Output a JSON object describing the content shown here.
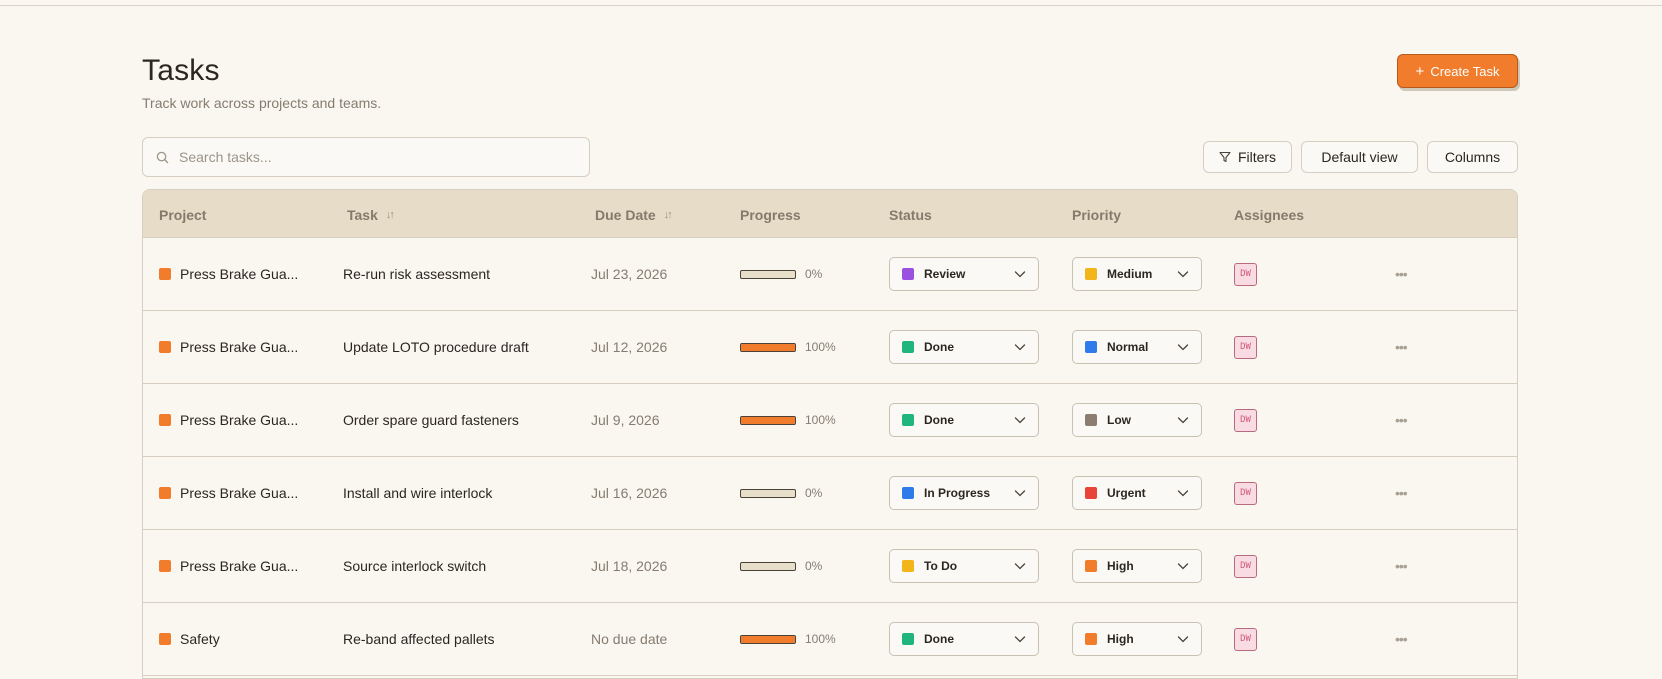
{
  "header": {
    "title": "Tasks",
    "subtitle": "Track work across projects and teams.",
    "create_label": "Create Task"
  },
  "search": {
    "placeholder": "Search tasks..."
  },
  "toolbar": {
    "filters_label": "Filters",
    "default_view_label": "Default view",
    "columns_label": "Columns"
  },
  "columns": {
    "project": "Project",
    "task": "Task",
    "due": "Due Date",
    "progress": "Progress",
    "status": "Status",
    "priority": "Priority",
    "assignees": "Assignees"
  },
  "colors": {
    "accent": "#f07c2c",
    "review": "#9b51e0",
    "done": "#1fb57d",
    "in_progress": "#2f7bea",
    "todo": "#f2b51a",
    "medium": "#f2b51a",
    "normal": "#2f7bea",
    "low": "#8c7d73",
    "urgent": "#e9443a",
    "high": "#f07c2c"
  },
  "rows": [
    {
      "project": "Press Brake Gua...",
      "task": "Re-run risk assessment",
      "due": "Jul 23, 2026",
      "progress": 0,
      "progress_label": "0%",
      "status": "Review",
      "status_color": "#9b51e0",
      "priority": "Medium",
      "priority_color": "#f2b51a",
      "assignee": "DW"
    },
    {
      "project": "Press Brake Gua...",
      "task": "Update LOTO procedure draft",
      "due": "Jul 12, 2026",
      "progress": 100,
      "progress_label": "100%",
      "status": "Done",
      "status_color": "#1fb57d",
      "priority": "Normal",
      "priority_color": "#2f7bea",
      "assignee": "DW"
    },
    {
      "project": "Press Brake Gua...",
      "task": "Order spare guard fasteners",
      "due": "Jul 9, 2026",
      "progress": 100,
      "progress_label": "100%",
      "status": "Done",
      "status_color": "#1fb57d",
      "priority": "Low",
      "priority_color": "#8c7d73",
      "assignee": "DW"
    },
    {
      "project": "Press Brake Gua...",
      "task": "Install and wire interlock",
      "due": "Jul 16, 2026",
      "progress": 0,
      "progress_label": "0%",
      "status": "In Progress",
      "status_color": "#2f7bea",
      "priority": "Urgent",
      "priority_color": "#e9443a",
      "assignee": "DW"
    },
    {
      "project": "Press Brake Gua...",
      "task": "Source interlock switch",
      "due": "Jul 18, 2026",
      "progress": 0,
      "progress_label": "0%",
      "status": "To Do",
      "status_color": "#f2b51a",
      "priority": "High",
      "priority_color": "#f07c2c",
      "assignee": "DW"
    },
    {
      "project": "Safety",
      "task": "Re-band affected pallets",
      "due": "No due date",
      "progress": 100,
      "progress_label": "100%",
      "status": "Done",
      "status_color": "#1fb57d",
      "priority": "High",
      "priority_color": "#f07c2c",
      "assignee": "DW"
    }
  ]
}
